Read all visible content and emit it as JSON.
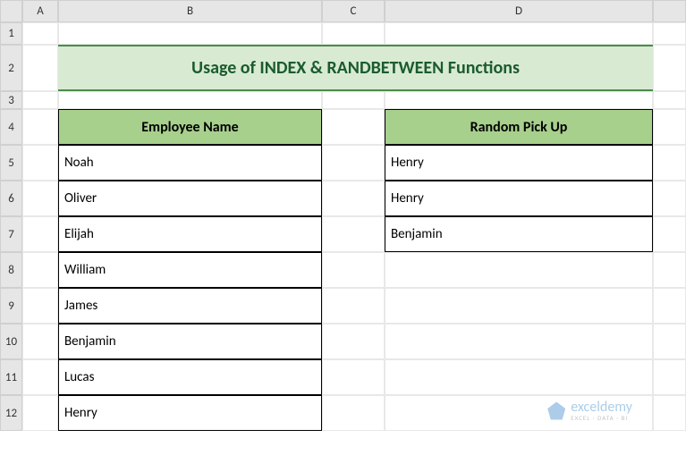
{
  "columns": [
    "A",
    "B",
    "C",
    "D"
  ],
  "rows": [
    "1",
    "2",
    "3",
    "4",
    "5",
    "6",
    "7",
    "8",
    "9",
    "10",
    "11",
    "12"
  ],
  "title": "Usage of INDEX & RANDBETWEEN Functions",
  "headers": {
    "employee": "Employee Name",
    "random": "Random Pick Up"
  },
  "employees": [
    "Noah",
    "Oliver",
    "Elijah",
    "William",
    "James",
    "Benjamin",
    "Lucas",
    "Henry"
  ],
  "random_picks": [
    "Henry",
    "Henry",
    "Benjamin"
  ],
  "watermark": {
    "brand": "exceldemy",
    "sub": "EXCEL · DATA · BI"
  }
}
